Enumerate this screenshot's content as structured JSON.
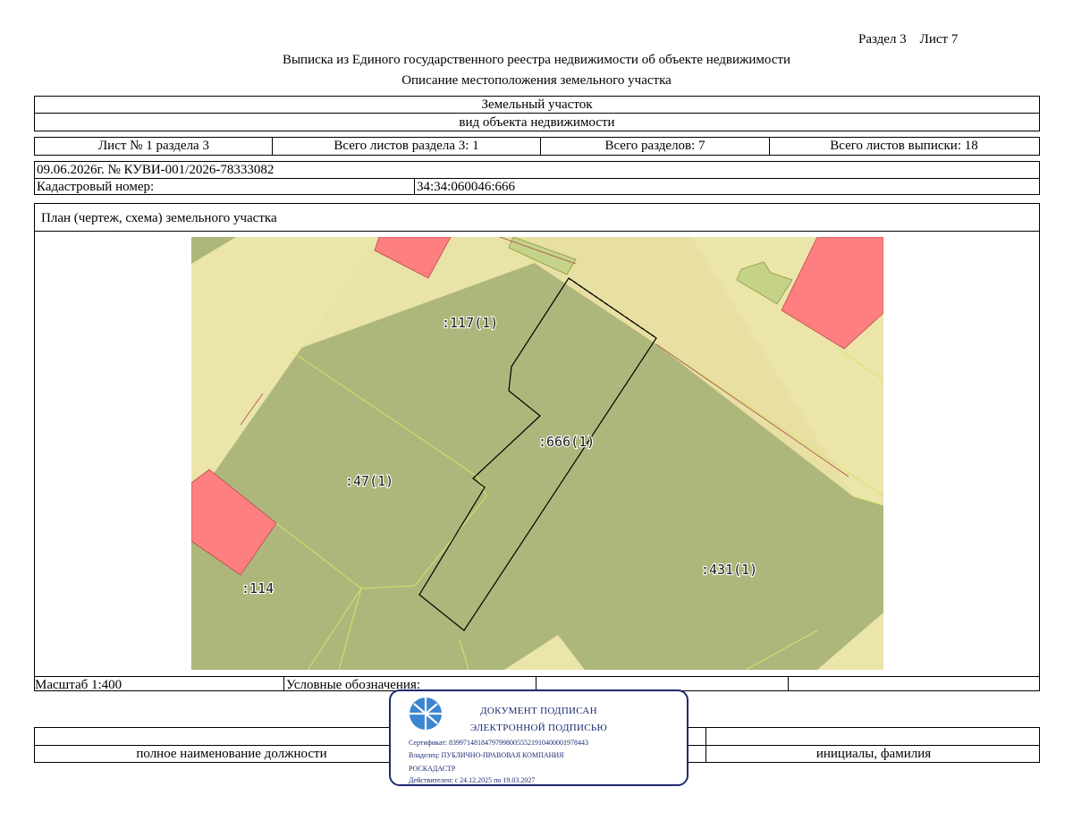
{
  "header": {
    "section_sheet": "Раздел 3    Лист 7",
    "title": "Выписка из Единого государственного реестра недвижимости об объекте недвижимости",
    "subtitle": "Описание местоположения земельного участка"
  },
  "object": {
    "type_value": "Земельный участок",
    "type_caption": "вид объекта недвижимости"
  },
  "sheet_info": {
    "sheet_no": "Лист № 1 раздела 3",
    "total_section_sheets": "Всего листов раздела 3: 1",
    "total_sections": "Всего разделов: 7",
    "total_extract_sheets": "Всего листов выписки: 18"
  },
  "registration": {
    "date_number": "09.06.2026г. № КУВИ-001/2026-78333082",
    "cadastral_label": "Кадастровый номер:",
    "cadastral_value": "34:34:060046:666"
  },
  "plan": {
    "caption": "План (чертеж, схема) земельного участка",
    "parcel_labels": [
      ":117(1)",
      ":666(1)",
      ":47(1)",
      ":431(1)",
      ":114"
    ]
  },
  "footer": {
    "scale": "Масштаб 1:400",
    "legend_label": "Условные обозначения:",
    "position_caption": "полное наименование должности",
    "name_caption": "инициалы, фамилия"
  },
  "stamp": {
    "line1": "ДОКУМЕНТ ПОДПИСАН",
    "line2": "ЭЛЕКТРОННОЙ ПОДПИСЬЮ",
    "certificate": "Сертификат: 839971481847979980055521910400001978443",
    "owner": "Владелец: ПУБЛИЧНО-ПРАВОВАЯ КОМПАНИЯ",
    "owner2": "РОСКАДАСТР",
    "valid": "Действителен: с 24.12.2025 по 19.03.2027"
  },
  "colors": {
    "parcel_fill": "#adb77c",
    "road_fill": "#ece5aa",
    "building_fill": "#fd7f7f",
    "subject_outline": "#000000",
    "stamp_color": "#1d2a72"
  }
}
